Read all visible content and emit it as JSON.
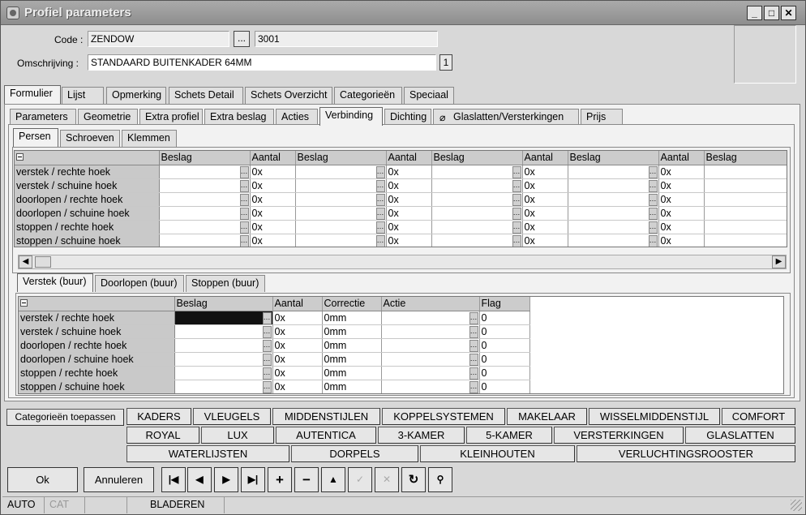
{
  "window": {
    "title": "Profiel parameters"
  },
  "form": {
    "code_label": "Code :",
    "code_value": "ZENDOW",
    "code_number": "3001",
    "omschrijving_label": "Omschrijving :",
    "omschrijving_value": "STANDAARD BUITENKADER 64MM",
    "omschrijving_lang": "1",
    "lookup_label": "..."
  },
  "main_tabs": [
    "Formulier",
    "Lijst",
    "Opmerking",
    "Schets Detail",
    "Schets Overzicht",
    "Categorieën",
    "Speciaal"
  ],
  "sub_tabs": [
    "Parameters",
    "Geometrie",
    "Extra profiel",
    "Extra beslag",
    "Acties",
    "Verbinding",
    "Dichting",
    "Glaslatten/Versterkingen",
    "Prijs"
  ],
  "inner_tabs": [
    "Persen",
    "Schroeven",
    "Klemmen"
  ],
  "grid1": {
    "headers": [
      "Beslag",
      "Aantal",
      "Beslag",
      "Aantal",
      "Beslag",
      "Aantal",
      "Beslag",
      "Aantal",
      "Beslag"
    ],
    "rows": [
      {
        "label": "verstek / rechte hoek",
        "aantal": "0x"
      },
      {
        "label": "verstek / schuine hoek",
        "aantal": "0x"
      },
      {
        "label": "doorlopen / rechte hoek",
        "aantal": "0x"
      },
      {
        "label": "doorlopen / schuine hoek",
        "aantal": "0x"
      },
      {
        "label": "stoppen / rechte hoek",
        "aantal": "0x"
      },
      {
        "label": "stoppen / schuine hoek",
        "aantal": "0x"
      }
    ]
  },
  "lower_tabs": [
    "Verstek (buur)",
    "Doorlopen (buur)",
    "Stoppen (buur)"
  ],
  "grid2": {
    "headers": [
      "Beslag",
      "Aantal",
      "Correctie",
      "Actie",
      "Flag"
    ],
    "rows": [
      {
        "label": "verstek / rechte hoek",
        "aantal": "0x",
        "correctie": "0mm",
        "flag": "0"
      },
      {
        "label": "verstek / schuine hoek",
        "aantal": "0x",
        "correctie": "0mm",
        "flag": "0"
      },
      {
        "label": "doorlopen / rechte hoek",
        "aantal": "0x",
        "correctie": "0mm",
        "flag": "0"
      },
      {
        "label": "doorlopen / schuine hoek",
        "aantal": "0x",
        "correctie": "0mm",
        "flag": "0"
      },
      {
        "label": "stoppen / rechte hoek",
        "aantal": "0x",
        "correctie": "0mm",
        "flag": "0"
      },
      {
        "label": "stoppen / schuine hoek",
        "aantal": "0x",
        "correctie": "0mm",
        "flag": "0"
      }
    ]
  },
  "categories": {
    "apply_label": "Categorieën toepassen",
    "row1": [
      "KADERS",
      "VLEUGELS",
      "MIDDENSTIJLEN",
      "KOPPELSYSTEMEN",
      "MAKELAAR",
      "WISSELMIDDENSTIJL",
      "COMFORT"
    ],
    "row2": [
      "ROYAL",
      "LUX",
      "AUTENTICA",
      "3-KAMER",
      "5-KAMER",
      "VERSTERKINGEN",
      "GLASLATTEN"
    ],
    "row3": [
      "WATERLIJSTEN",
      "DORPELS",
      "KLEINHOUTEN",
      "VERLUCHTINGSROOSTER"
    ]
  },
  "buttons": {
    "ok": "Ok",
    "cancel": "Annuleren"
  },
  "status": {
    "mode1": "AUTO",
    "mode2": "CAT",
    "state": "BLADEREN"
  }
}
